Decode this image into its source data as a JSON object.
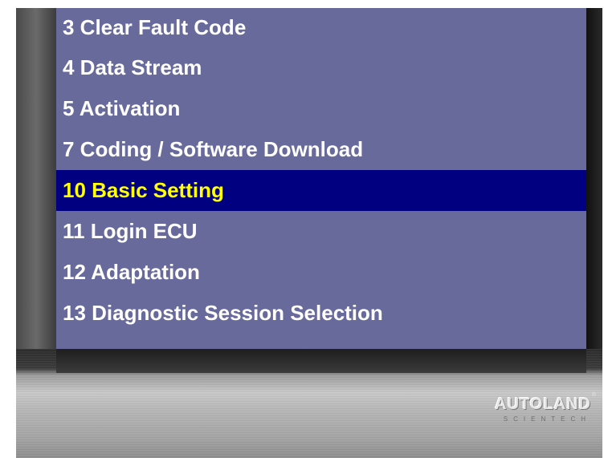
{
  "menu": {
    "items": [
      {
        "label": "3 Clear Fault Code",
        "selected": false
      },
      {
        "label": "4 Data Stream",
        "selected": false
      },
      {
        "label": "5 Activation",
        "selected": false
      },
      {
        "label": "7 Coding / Software Download",
        "selected": false
      },
      {
        "label": "10 Basic Setting",
        "selected": true
      },
      {
        "label": "11 Login ECU",
        "selected": false
      },
      {
        "label": "12 Adaptation",
        "selected": false
      },
      {
        "label": "13 Diagnostic Session Selection",
        "selected": false
      }
    ]
  },
  "brand": {
    "name": "AUTOLAND",
    "tagline": "SCIENTECH",
    "reg_mark": "®"
  },
  "colors": {
    "screen_bg": "#686a9c",
    "selected_bg": "#000080",
    "selected_text": "#ffff00",
    "item_text": "#ffffff"
  }
}
